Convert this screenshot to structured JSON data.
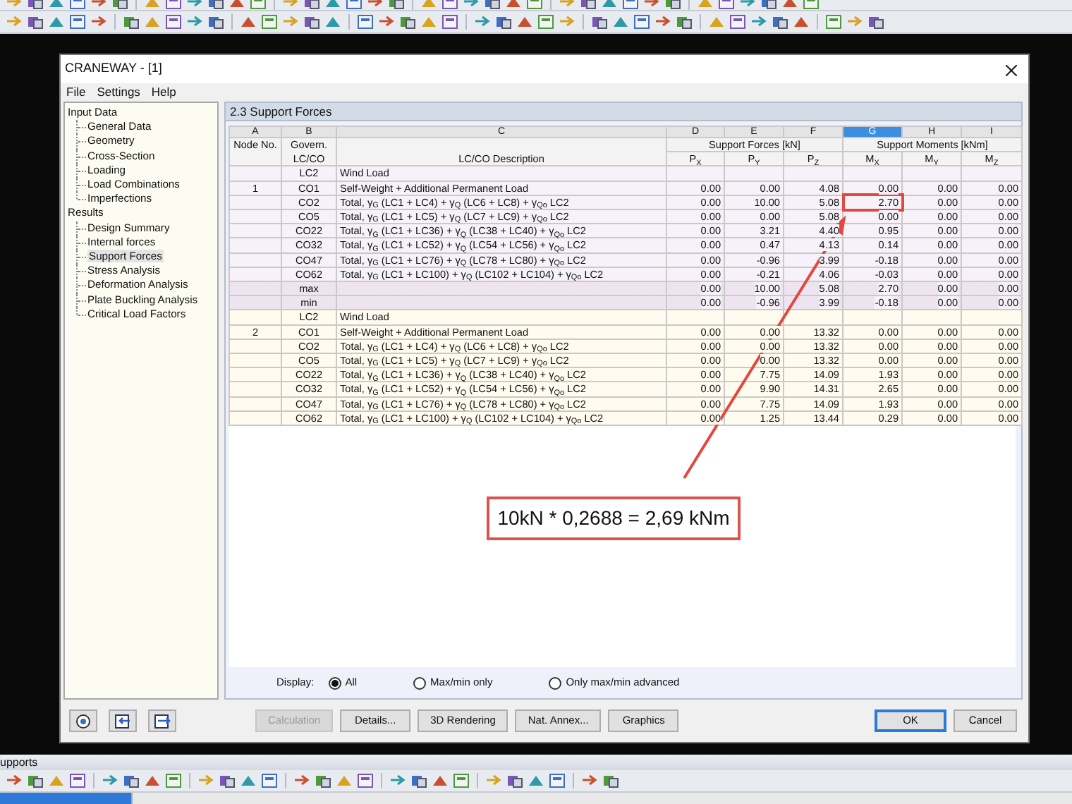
{
  "window": {
    "title": "CRANEWAY - [1]"
  },
  "menu": [
    "File",
    "Settings",
    "Help"
  ],
  "nav": [
    {
      "label": "Input Data",
      "children": [
        {
          "label": "General Data",
          "selected": false
        },
        {
          "label": "Geometry",
          "selected": false
        },
        {
          "label": "Cross-Section",
          "selected": false
        },
        {
          "label": "Loading",
          "selected": false
        },
        {
          "label": "Load Combinations",
          "selected": false
        },
        {
          "label": "Imperfections",
          "selected": false
        }
      ]
    },
    {
      "label": "Results",
      "children": [
        {
          "label": "Design Summary",
          "selected": false
        },
        {
          "label": "Internal forces",
          "selected": false
        },
        {
          "label": "Support Forces",
          "selected": true
        },
        {
          "label": "Stress Analysis",
          "selected": false
        },
        {
          "label": "Deformation Analysis",
          "selected": false
        },
        {
          "label": "Plate Buckling Analysis",
          "selected": false
        },
        {
          "label": "Critical Load Factors",
          "selected": false
        }
      ]
    }
  ],
  "panel": {
    "title": "2.3 Support Forces"
  },
  "table": {
    "columns": [
      {
        "letter": "A",
        "selected": false
      },
      {
        "letter": "B",
        "selected": false
      },
      {
        "letter": "C",
        "selected": false
      },
      {
        "letter": "D",
        "selected": false
      },
      {
        "letter": "E",
        "selected": false
      },
      {
        "letter": "F",
        "selected": false
      },
      {
        "letter": "G",
        "selected": true
      },
      {
        "letter": "H",
        "selected": false
      },
      {
        "letter": "I",
        "selected": false
      }
    ],
    "header": {
      "node": "Node No.",
      "lc": "Govern. LC/CO",
      "description": "LC/CO Description",
      "groups": [
        {
          "label": "Support Forces [kN]",
          "quantities": [
            "P$_{X}$",
            "P$_{Y}$",
            "P$_{Z}$"
          ]
        },
        {
          "label": "Support Moments [kNm]",
          "quantities": [
            "M$_{X}$",
            "M$_{Y}$",
            "M$_{Z}$"
          ]
        }
      ]
    },
    "groups": [
      {
        "color": "#f7f1f9",
        "rows": [
          {
            "kind": "case",
            "lc": "LC2",
            "description": "Wind Load",
            "boxed": false
          },
          {
            "kind": "case",
            "node": "1",
            "lc": "CO1",
            "description": "Self-Weight + Additional Permanent Load",
            "values": [
              "0.00",
              "0.00",
              "4.08",
              "0.00",
              "0.00",
              "0.00"
            ],
            "boxed": false
          },
          {
            "kind": "case",
            "lc": "CO2",
            "description": "Total, γ$_{G}$ (LC1 + LC4) + γ$_{Q}$ (LC6 + LC8) + γ$_{Qo}$ LC2",
            "values": [
              "0.00",
              "10.00",
              "5.08",
              "2.70",
              "0.00",
              "0.00"
            ],
            "boxed": true
          },
          {
            "kind": "case",
            "lc": "CO5",
            "description": "Total, γ$_{G}$ (LC1 + LC5) + γ$_{Q}$ (LC7 + LC9) + γ$_{Qo}$ LC2",
            "values": [
              "0.00",
              "0.00",
              "5.08",
              "0.00",
              "0.00",
              "0.00"
            ],
            "boxed": false
          },
          {
            "kind": "case",
            "lc": "CO22",
            "description": "Total, γ$_{G}$ (LC1 + LC36) + γ$_{Q}$ (LC38 + LC40) + γ$_{Qo}$ LC2",
            "values": [
              "0.00",
              "3.21",
              "4.40",
              "0.95",
              "0.00",
              "0.00"
            ],
            "boxed": false
          },
          {
            "kind": "case",
            "lc": "CO32",
            "description": "Total, γ$_{G}$ (LC1 + LC52) + γ$_{Q}$ (LC54 + LC56) + γ$_{Qo}$ LC2",
            "values": [
              "0.00",
              "0.47",
              "4.13",
              "0.14",
              "0.00",
              "0.00"
            ],
            "boxed": false
          },
          {
            "kind": "case",
            "lc": "CO47",
            "description": "Total, γ$_{G}$ (LC1 + LC76) + γ$_{Q}$ (LC78 + LC80) + γ$_{Qo}$ LC2",
            "values": [
              "0.00",
              "-0.96",
              "3.99",
              "-0.18",
              "0.00",
              "0.00"
            ],
            "boxed": false
          },
          {
            "kind": "case",
            "lc": "CO62",
            "description": "Total, γ$_{G}$ (LC1 + LC100) + γ$_{Q}$ (LC102 + LC104) + γ$_{Qo}$ LC2",
            "values": [
              "0.00",
              "-0.21",
              "4.06",
              "-0.03",
              "0.00",
              "0.00"
            ],
            "boxed": false
          },
          {
            "kind": "extreme",
            "lc": "max",
            "values": [
              "0.00",
              "10.00",
              "5.08",
              "2.70",
              "0.00",
              "0.00"
            ],
            "boxed": false
          },
          {
            "kind": "extreme",
            "lc": "min",
            "values": [
              "0.00",
              "-0.96",
              "3.99",
              "-0.18",
              "0.00",
              "0.00"
            ],
            "boxed": false
          }
        ]
      },
      {
        "color": "#fffbee",
        "rows": [
          {
            "kind": "case",
            "lc": "LC2",
            "description": "Wind Load",
            "boxed": false
          },
          {
            "kind": "case",
            "node": "2",
            "lc": "CO1",
            "description": "Self-Weight + Additional Permanent Load",
            "values": [
              "0.00",
              "0.00",
              "13.32",
              "0.00",
              "0.00",
              "0.00"
            ],
            "boxed": false
          },
          {
            "kind": "case",
            "lc": "CO2",
            "description": "Total, γ$_{G}$ (LC1 + LC4) + γ$_{Q}$ (LC6 + LC8) + γ$_{Qo}$ LC2",
            "values": [
              "0.00",
              "0.00",
              "13.32",
              "0.00",
              "0.00",
              "0.00"
            ],
            "boxed": false
          },
          {
            "kind": "case",
            "lc": "CO5",
            "description": "Total, γ$_{G}$ (LC1 + LC5) + γ$_{Q}$ (LC7 + LC9) + γ$_{Qo}$ LC2",
            "values": [
              "0.00",
              "0.00",
              "13.32",
              "0.00",
              "0.00",
              "0.00"
            ],
            "boxed": false
          },
          {
            "kind": "case",
            "lc": "CO22",
            "description": "Total, γ$_{G}$ (LC1 + LC36) + γ$_{Q}$ (LC38 + LC40) + γ$_{Qo}$ LC2",
            "values": [
              "0.00",
              "7.75",
              "14.09",
              "1.93",
              "0.00",
              "0.00"
            ],
            "boxed": false
          },
          {
            "kind": "case",
            "lc": "CO32",
            "description": "Total, γ$_{G}$ (LC1 + LC52) + γ$_{Q}$ (LC54 + LC56) + γ$_{Qo}$ LC2",
            "values": [
              "0.00",
              "9.90",
              "14.31",
              "2.65",
              "0.00",
              "0.00"
            ],
            "boxed": false
          },
          {
            "kind": "case",
            "lc": "CO47",
            "description": "Total, γ$_{G}$ (LC1 + LC76) + γ$_{Q}$ (LC78 + LC80) + γ$_{Qo}$ LC2",
            "values": [
              "0.00",
              "7.75",
              "14.09",
              "1.93",
              "0.00",
              "0.00"
            ],
            "boxed": false
          },
          {
            "kind": "case",
            "lc": "CO62",
            "description": "Total, γ$_{G}$ (LC1 + LC100) + γ$_{Q}$ (LC102 + LC104) + γ$_{Qo}$ LC2",
            "values": [
              "0.00",
              "1.25",
              "13.44",
              "0.29",
              "0.00",
              "0.00"
            ],
            "boxed": false
          }
        ]
      }
    ]
  },
  "callout": {
    "text": "10kN * 0,2688 = 2,69 kNm"
  },
  "display": {
    "label": "Display:",
    "options": [
      {
        "label": "All",
        "selected": true
      },
      {
        "label": "Max/min only",
        "selected": false
      },
      {
        "label": "Only max/min advanced",
        "selected": false
      }
    ]
  },
  "buttons": [
    {
      "label": "Calculation",
      "disabled": true,
      "default": false
    },
    {
      "label": "Details...",
      "disabled": false,
      "default": false
    },
    {
      "label": "3D Rendering",
      "disabled": false,
      "default": false
    },
    {
      "label": "Nat. Annex...",
      "disabled": false,
      "default": false
    },
    {
      "label": "Graphics",
      "disabled": false,
      "default": false
    }
  ],
  "dialog_buttons": [
    {
      "label": "OK",
      "disabled": false,
      "default": true
    },
    {
      "label": "Cancel",
      "disabled": false,
      "default": false
    }
  ],
  "bottom_panel": {
    "title": "upports"
  }
}
